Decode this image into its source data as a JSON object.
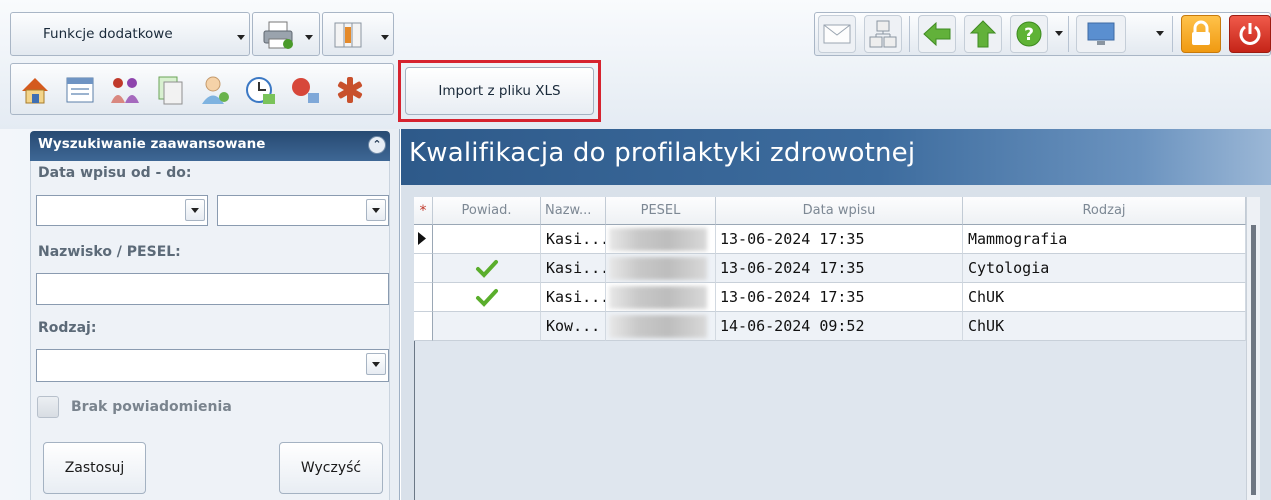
{
  "toolbar": {
    "functions_label": "Funkcje dodatkowe",
    "import_button_label": "Import z pliku XLS"
  },
  "search_panel": {
    "title": "Wyszukiwanie zaawansowane",
    "date_range_label": "Data wpisu od - do:",
    "surname_pesel_label": "Nazwisko / PESEL:",
    "type_label": "Rodzaj:",
    "no_notification_label": "Brak powiadomienia",
    "apply_button": "Zastosuj",
    "clear_button": "Wyczyść"
  },
  "main": {
    "title": "Kwalifikacja do profilaktyki zdrowotnej"
  },
  "grid": {
    "columns": [
      "Powiad.",
      "Nazw...",
      "PESEL",
      "Data wpisu",
      "Rodzaj"
    ],
    "rows": [
      {
        "notified": false,
        "surname": "Kasi...",
        "date": "13-06-2024 17:35",
        "type": "Mammografia"
      },
      {
        "notified": true,
        "surname": "Kasi...",
        "date": "13-06-2024 17:35",
        "type": "Cytologia"
      },
      {
        "notified": true,
        "surname": "Kasi...",
        "date": "13-06-2024 17:35",
        "type": "ChUK"
      },
      {
        "notified": false,
        "surname": "Kow...",
        "date": "14-06-2024 09:52",
        "type": "ChUK"
      }
    ]
  },
  "colors": {
    "header_blue": "#2e5a8a",
    "highlight_red": "#d6232f",
    "check_green": "#5aae2c"
  }
}
